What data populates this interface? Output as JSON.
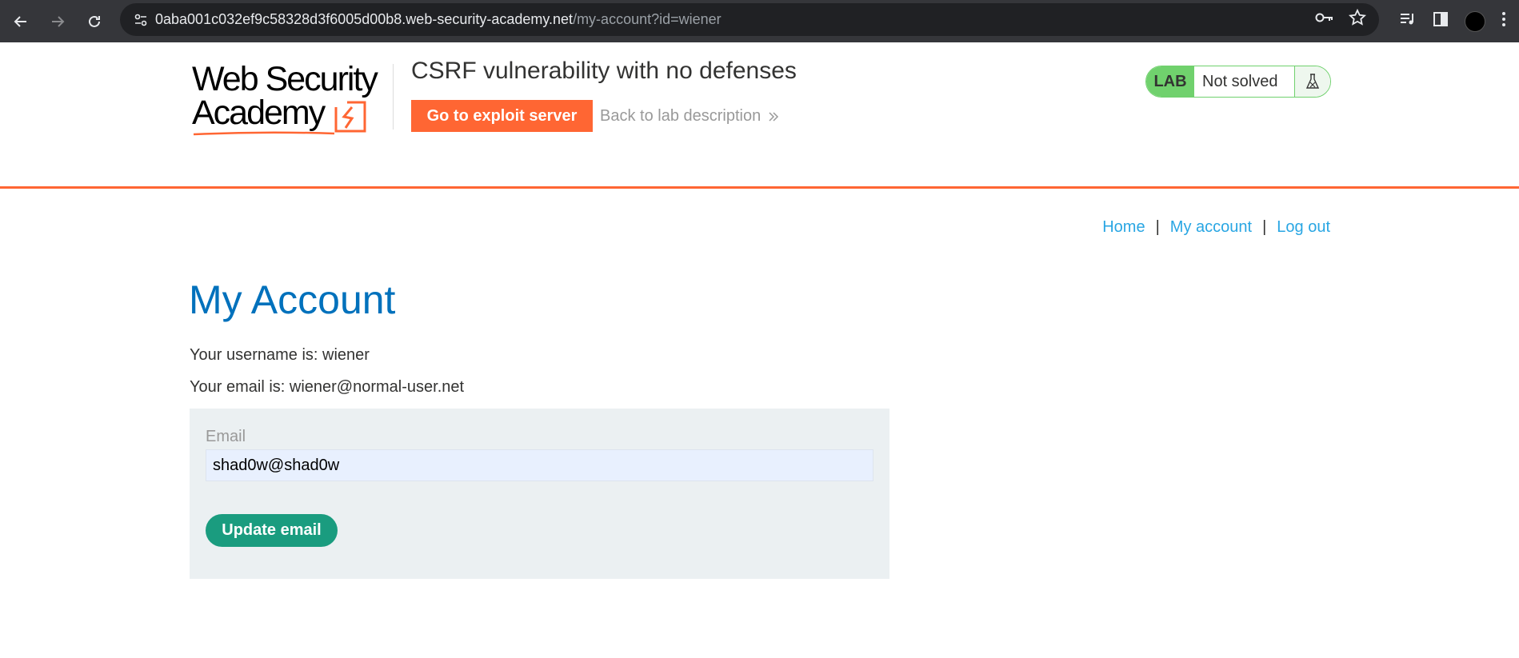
{
  "browser": {
    "url_host": "0aba001c032ef9c58328d3f6005d00b8.web-security-academy.net",
    "url_path": "/my-account?id=wiener"
  },
  "lab": {
    "logo_line1": "Web Security",
    "logo_line2": "Academy",
    "title": "CSRF vulnerability with no defenses",
    "exploit_button": "Go to exploit server",
    "back_link": "Back to lab description",
    "badge": "LAB",
    "status": "Not solved",
    "accent_color": "#ff6633",
    "status_color": "#70d16d"
  },
  "nav": {
    "home": "Home",
    "separator": "|",
    "my_account": "My account",
    "log_out": "Log out"
  },
  "account": {
    "title": "My Account",
    "username_line": "Your username is: wiener",
    "email_line": "Your email is: wiener@normal-user.net",
    "email_label": "Email",
    "email_value": "shad0w@shad0w",
    "update_button": "Update email"
  }
}
